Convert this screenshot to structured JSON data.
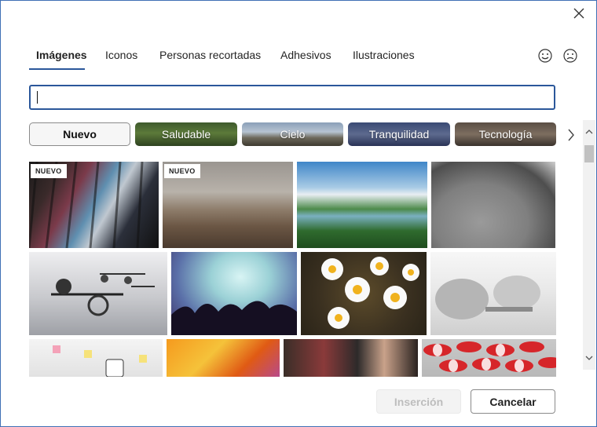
{
  "tabs": [
    {
      "label": "Imágenes",
      "active": true
    },
    {
      "label": "Iconos"
    },
    {
      "label": "Personas recortadas"
    },
    {
      "label": "Adhesivos"
    },
    {
      "label": "Ilustraciones"
    }
  ],
  "search": {
    "value": "",
    "placeholder": ""
  },
  "categories": [
    {
      "label": "Nuevo"
    },
    {
      "label": "Saludable"
    },
    {
      "label": "Cielo"
    },
    {
      "label": "Tranquilidad"
    },
    {
      "label": "Tecnología"
    }
  ],
  "images": {
    "badge_new": "NUEVO"
  },
  "buttons": {
    "insert_label": "Inserción",
    "cancel_label": "Cancelar"
  },
  "colors": {
    "accent": "#2b579a",
    "disabled_text": "#bdbdbd"
  },
  "icons": {
    "close": "close-icon",
    "happy": "smile-icon",
    "sad": "frown-icon",
    "next": "chevron-right-icon"
  }
}
